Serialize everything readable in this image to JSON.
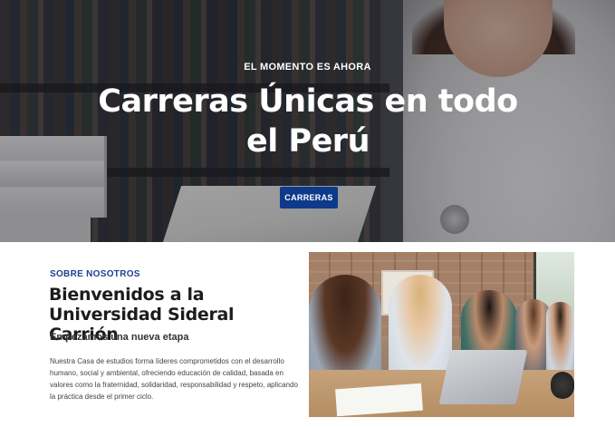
{
  "hero": {
    "eyebrow": "EL MOMENTO ES AHORA",
    "title": "Carreras Únicas en todo el Perú",
    "button_label": "CARRERAS",
    "button_color": "#0d3a8a"
  },
  "about": {
    "eyebrow": "SOBRE NOSOTROS",
    "title": "Bienvenidos a la Universidad Sideral Carrión",
    "subtitle": "Empezamos una nueva etapa",
    "text": "Nuestra Casa de estudios forma líderes comprometidos con el desarrollo humano, social y ambiental, ofreciendo educación de calidad, basada en valores como la fraternidad, solidaridad, responsabilidad y respeto, aplicando la práctica desde el primer ciclo.",
    "eyebrow_color": "#1f3f8f"
  }
}
